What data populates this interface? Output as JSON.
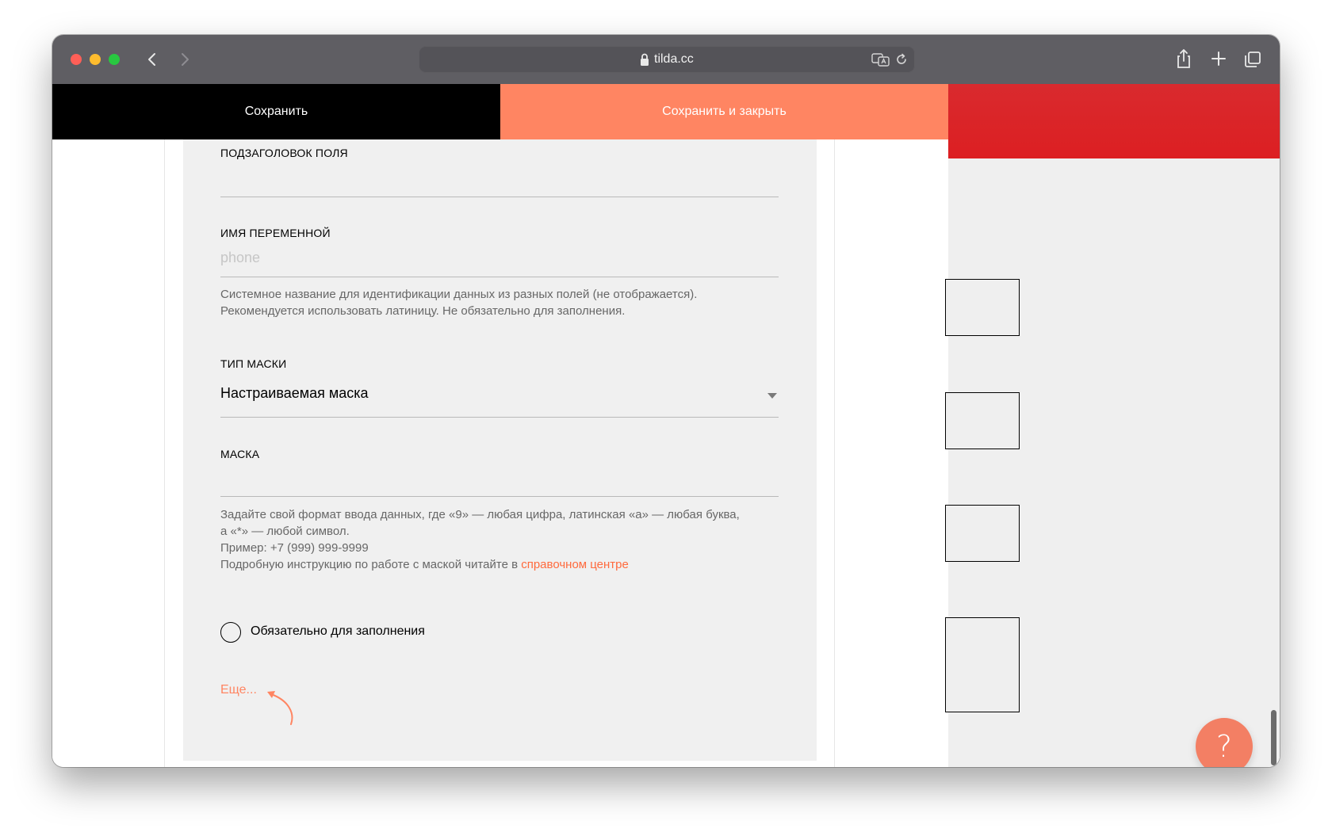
{
  "browser": {
    "url": "tilda.cc"
  },
  "toolbar": {
    "save_label": "Сохранить",
    "save_close_label": "Сохранить и закрыть"
  },
  "form": {
    "subtitle_label": "ПОДЗАГОЛОВОК ПОЛЯ",
    "subtitle_value": "",
    "variable_label": "ИМЯ ПЕРЕМЕННОЙ",
    "variable_placeholder": "phone",
    "variable_hint_line1": "Системное название для идентификации данных из разных полей (не отображается).",
    "variable_hint_line2": "Рекомендуется использовать латиницу. Не обязательно для заполнения.",
    "mask_type_label": "ТИП МАСКИ",
    "mask_type_value": "Настраиваемая маска",
    "mask_label": "МАСКА",
    "mask_value": "",
    "mask_hint_line1": "Задайте свой формат ввода данных, где «9» — любая цифра, латинская «a» — любая буква,",
    "mask_hint_line2": "а «*» — любой символ.",
    "mask_hint_line3": "Пример: +7 (999) 999-9999",
    "mask_hint_line4": "Подробную инструкцию по работе с маской читайте в ",
    "mask_hint_link": "справочном центре",
    "required_label": "Обязательно для заполнения",
    "required_checked": false,
    "more_label": "Еще..."
  },
  "help": {
    "label": "?"
  },
  "colors": {
    "accent": "#ff8562",
    "link": "#ff6a3d",
    "banner": "#dc1f22",
    "toolbar_dark": "#000000"
  }
}
